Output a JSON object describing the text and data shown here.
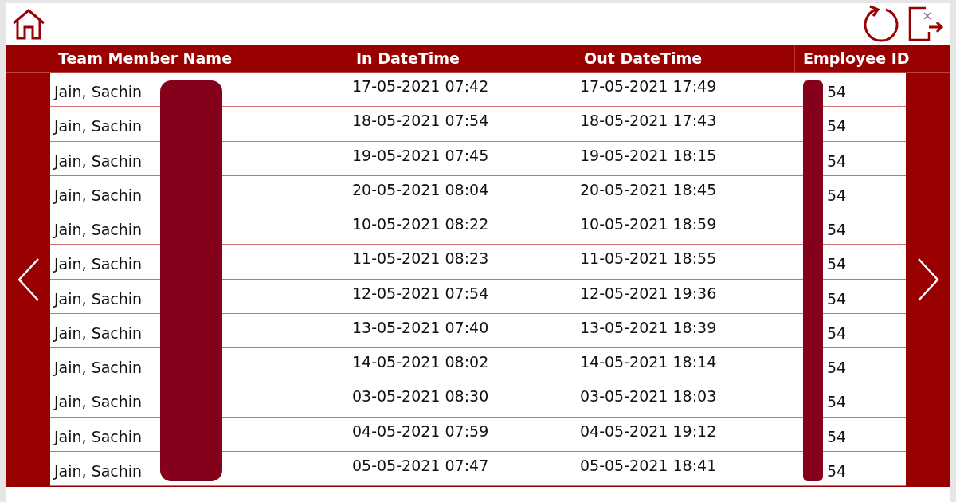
{
  "columns": [
    "Team Member Name",
    "In DateTime",
    "Out DateTime",
    "Employee ID"
  ],
  "rows": [
    {
      "name": "Jain, Sachin",
      "in": "17-05-2021 07:42",
      "out": "17-05-2021 17:49",
      "employee_id": "54"
    },
    {
      "name": "Jain, Sachin",
      "in": "18-05-2021 07:54",
      "out": "18-05-2021 17:43",
      "employee_id": "54"
    },
    {
      "name": "Jain, Sachin",
      "in": "19-05-2021 07:45",
      "out": "19-05-2021 18:15",
      "employee_id": "54"
    },
    {
      "name": "Jain, Sachin",
      "in": "20-05-2021 08:04",
      "out": "20-05-2021 18:45",
      "employee_id": "54"
    },
    {
      "name": "Jain, Sachin",
      "in": "10-05-2021 08:22",
      "out": "10-05-2021 18:59",
      "employee_id": "54"
    },
    {
      "name": "Jain, Sachin",
      "in": "11-05-2021 08:23",
      "out": "11-05-2021 18:55",
      "employee_id": "54"
    },
    {
      "name": "Jain, Sachin",
      "in": "12-05-2021 07:54",
      "out": "12-05-2021 19:36",
      "employee_id": "54"
    },
    {
      "name": "Jain, Sachin",
      "in": "13-05-2021 07:40",
      "out": "13-05-2021 18:39",
      "employee_id": "54"
    },
    {
      "name": "Jain, Sachin",
      "in": "14-05-2021 08:02",
      "out": "14-05-2021 18:14",
      "employee_id": "54"
    },
    {
      "name": "Jain, Sachin",
      "in": "03-05-2021 08:30",
      "out": "03-05-2021 18:03",
      "employee_id": "54"
    },
    {
      "name": "Jain, Sachin",
      "in": "04-05-2021 07:59",
      "out": "04-05-2021 19:12",
      "employee_id": "54"
    },
    {
      "name": "Jain, Sachin",
      "in": "05-05-2021 07:47",
      "out": "05-05-2021 18:41",
      "employee_id": "54"
    }
  ]
}
